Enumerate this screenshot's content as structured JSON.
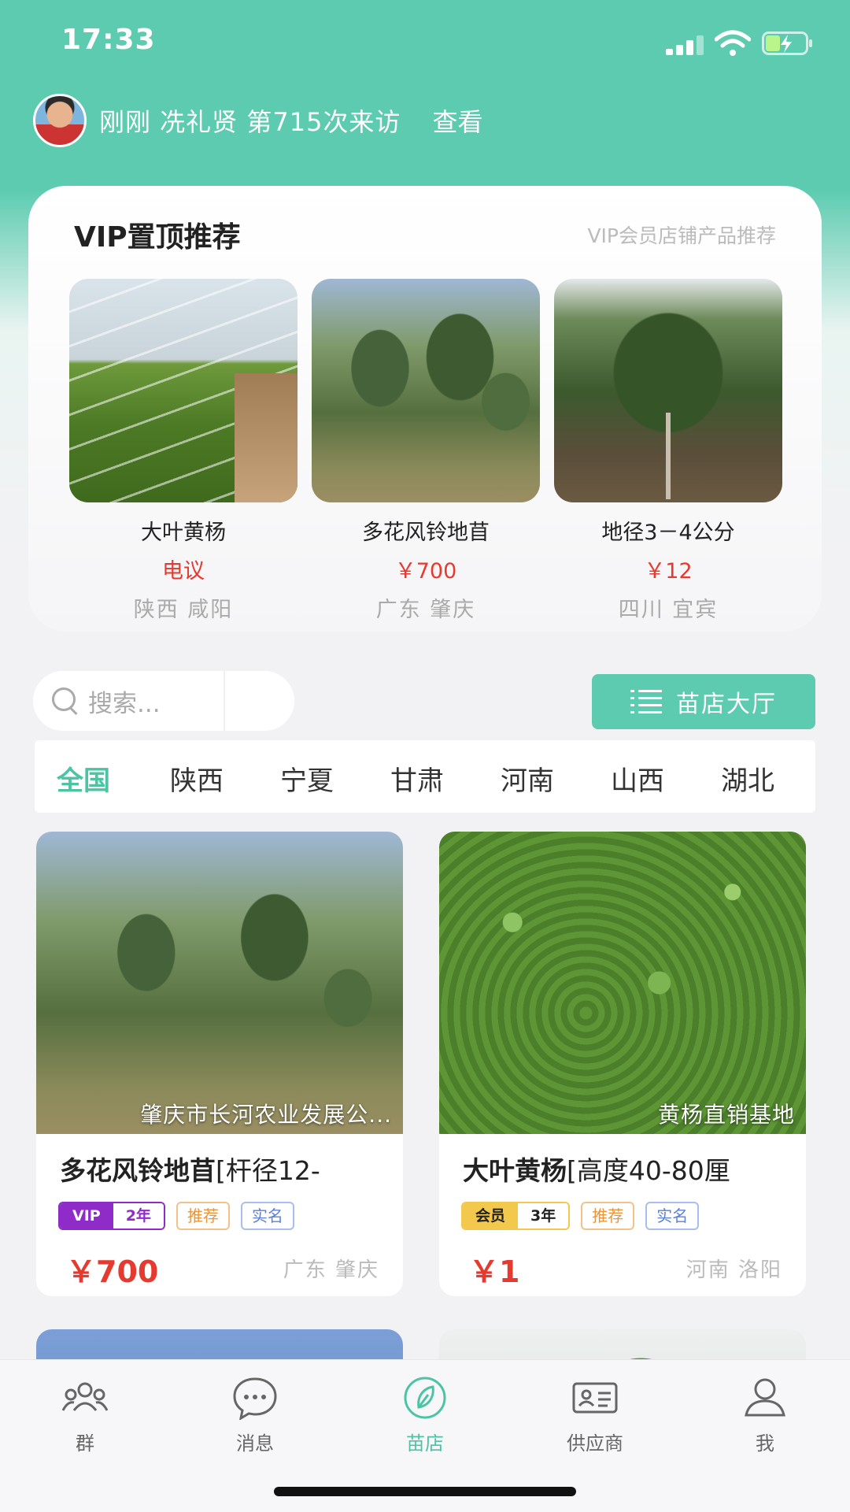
{
  "status_bar": {
    "time": "17:33"
  },
  "visitor": {
    "text": "刚刚 冼礼贤 第715次来访",
    "link": "查看"
  },
  "vip": {
    "title": "VIP置顶推荐",
    "subtitle": "VIP会员店铺产品推荐",
    "items": [
      {
        "name": "大叶黄杨",
        "price": "电议",
        "location": "陕西 咸阳"
      },
      {
        "name": "多花风铃地苜",
        "price": "￥700",
        "location": "广东 肇庆"
      },
      {
        "name": "地径3－4公分",
        "price": "￥12",
        "location": "四川 宜宾"
      }
    ]
  },
  "search": {
    "placeholder": "搜索..."
  },
  "hall_button": {
    "label": "苗店大厅"
  },
  "regions": [
    "全国",
    "陕西",
    "宁夏",
    "甘肃",
    "河南",
    "山西",
    "湖北"
  ],
  "products": [
    {
      "caption": "肇庆市长河农业发展公...",
      "title_bold": "多花风铃地苜",
      "title_rest": "[杆径12-",
      "badge_left": "VIP",
      "badge_right": "2年",
      "tag_recommend": "推荐",
      "tag_verified": "实名",
      "price": "￥700",
      "location": "广东 肇庆"
    },
    {
      "caption": "黄杨直销基地",
      "title_bold": "大叶黄杨",
      "title_rest": "[高度40-80厘",
      "badge_left": "会员",
      "badge_right": "3年",
      "tag_recommend": "推荐",
      "tag_verified": "实名",
      "price": "￥1",
      "location": "河南 洛阳"
    }
  ],
  "tabs": [
    {
      "label": "群",
      "icon": "group-icon"
    },
    {
      "label": "消息",
      "icon": "message-icon"
    },
    {
      "label": "苗店",
      "icon": "leaf-icon",
      "active": true
    },
    {
      "label": "供应商",
      "icon": "id-card-icon"
    },
    {
      "label": "我",
      "icon": "user-icon"
    }
  ],
  "colors": {
    "accent": "#5ccbb0",
    "price": "#e53a2f",
    "vip_purple": "#8e2bc9",
    "member_gold": "#f2c94c"
  }
}
